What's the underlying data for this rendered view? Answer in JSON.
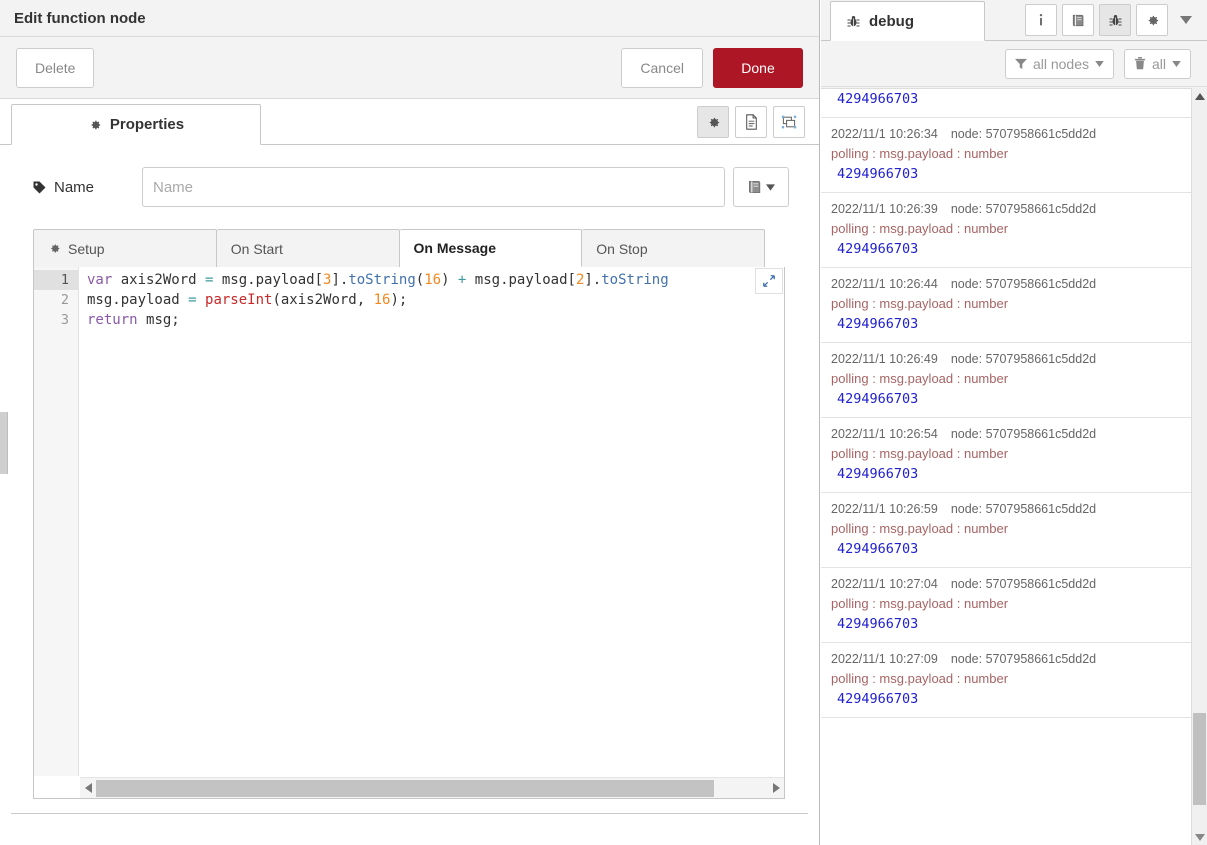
{
  "dialog": {
    "title": "Edit function node",
    "buttons": {
      "delete": "Delete",
      "cancel": "Cancel",
      "done": "Done"
    },
    "done_color": "#ad1625",
    "main_tab": "Properties",
    "tab_icons": [
      {
        "name": "gear-icon",
        "glyph": "gear",
        "active": true
      },
      {
        "name": "description-icon",
        "glyph": "doc",
        "active": false
      },
      {
        "name": "appearance-icon",
        "glyph": "appearance",
        "active": false
      }
    ],
    "name_field": {
      "label": "Name",
      "value": "",
      "placeholder": "Name",
      "icon": "tag-icon",
      "library_button_icon": "book-icon"
    },
    "code_tabs": [
      {
        "label": "Setup",
        "icon": "gear-icon",
        "active": false
      },
      {
        "label": "On Start",
        "icon": "",
        "active": false
      },
      {
        "label": "On Message",
        "icon": "",
        "active": true
      },
      {
        "label": "On Stop",
        "icon": "",
        "active": false
      }
    ],
    "editor": {
      "expand_icon": "expand-arrows-icon",
      "line_numbers": [
        "1",
        "2",
        "3"
      ],
      "active_line": 1,
      "lines": [
        [
          {
            "t": "var ",
            "c": "kw"
          },
          {
            "t": "axis2Word ",
            "c": "pl"
          },
          {
            "t": "= ",
            "c": "op"
          },
          {
            "t": "msg.payload",
            "c": "pl"
          },
          {
            "t": "[",
            "c": "pl"
          },
          {
            "t": "3",
            "c": "num"
          },
          {
            "t": "].",
            "c": "pl"
          },
          {
            "t": "toString",
            "c": "fn"
          },
          {
            "t": "(",
            "c": "pl"
          },
          {
            "t": "16",
            "c": "num"
          },
          {
            "t": ") ",
            "c": "pl"
          },
          {
            "t": "+ ",
            "c": "op"
          },
          {
            "t": "msg.payload",
            "c": "pl"
          },
          {
            "t": "[",
            "c": "pl"
          },
          {
            "t": "2",
            "c": "num"
          },
          {
            "t": "].",
            "c": "pl"
          },
          {
            "t": "toString",
            "c": "fn"
          }
        ],
        [
          {
            "t": "msg.payload ",
            "c": "pl"
          },
          {
            "t": "= ",
            "c": "op"
          },
          {
            "t": "parseInt",
            "c": "fnr"
          },
          {
            "t": "(axis2Word, ",
            "c": "pl"
          },
          {
            "t": "16",
            "c": "num"
          },
          {
            "t": ");",
            "c": "pl"
          }
        ],
        [
          {
            "t": "return ",
            "c": "kw"
          },
          {
            "t": "msg;",
            "c": "pl"
          }
        ]
      ],
      "hscroll": {
        "left_arrow": "◀",
        "right_arrow": "▶"
      }
    }
  },
  "debug": {
    "tab_label": "debug",
    "tab_icon": "bug-icon",
    "panel_icons": [
      {
        "name": "info-icon",
        "glyph": "i",
        "active": false
      },
      {
        "name": "help-book-icon",
        "glyph": "book",
        "active": false
      },
      {
        "name": "debug-bug-icon",
        "glyph": "bug",
        "active": true
      },
      {
        "name": "config-gear-icon",
        "glyph": "gear",
        "active": false
      }
    ],
    "panel_caret": "chevron-down-icon",
    "filters": [
      {
        "name": "node-filter",
        "icon": "filter-icon",
        "label": "all nodes",
        "caret": "▾"
      },
      {
        "name": "clear-filter",
        "icon": "trash-icon",
        "label": "all",
        "caret": "▾"
      }
    ],
    "messages": [
      {
        "clipped": true,
        "timestamp": "",
        "node_label": "",
        "node_id": "",
        "topic": "",
        "value": "4294966703"
      },
      {
        "clipped": false,
        "timestamp": "2022/11/1 10:26:34",
        "node_label": "node:",
        "node_id": "5707958661c5dd2d",
        "topic": "polling : msg.payload : number",
        "value": "4294966703"
      },
      {
        "clipped": false,
        "timestamp": "2022/11/1 10:26:39",
        "node_label": "node:",
        "node_id": "5707958661c5dd2d",
        "topic": "polling : msg.payload : number",
        "value": "4294966703"
      },
      {
        "clipped": false,
        "timestamp": "2022/11/1 10:26:44",
        "node_label": "node:",
        "node_id": "5707958661c5dd2d",
        "topic": "polling : msg.payload : number",
        "value": "4294966703"
      },
      {
        "clipped": false,
        "timestamp": "2022/11/1 10:26:49",
        "node_label": "node:",
        "node_id": "5707958661c5dd2d",
        "topic": "polling : msg.payload : number",
        "value": "4294966703"
      },
      {
        "clipped": false,
        "timestamp": "2022/11/1 10:26:54",
        "node_label": "node:",
        "node_id": "5707958661c5dd2d",
        "topic": "polling : msg.payload : number",
        "value": "4294966703"
      },
      {
        "clipped": false,
        "timestamp": "2022/11/1 10:26:59",
        "node_label": "node:",
        "node_id": "5707958661c5dd2d",
        "topic": "polling : msg.payload : number",
        "value": "4294966703"
      },
      {
        "clipped": false,
        "timestamp": "2022/11/1 10:27:04",
        "node_label": "node:",
        "node_id": "5707958661c5dd2d",
        "topic": "polling : msg.payload : number",
        "value": "4294966703"
      },
      {
        "clipped": false,
        "timestamp": "2022/11/1 10:27:09",
        "node_label": "node:",
        "node_id": "5707958661c5dd2d",
        "topic": "polling : msg.payload : number",
        "value": "4294966703"
      }
    ]
  }
}
